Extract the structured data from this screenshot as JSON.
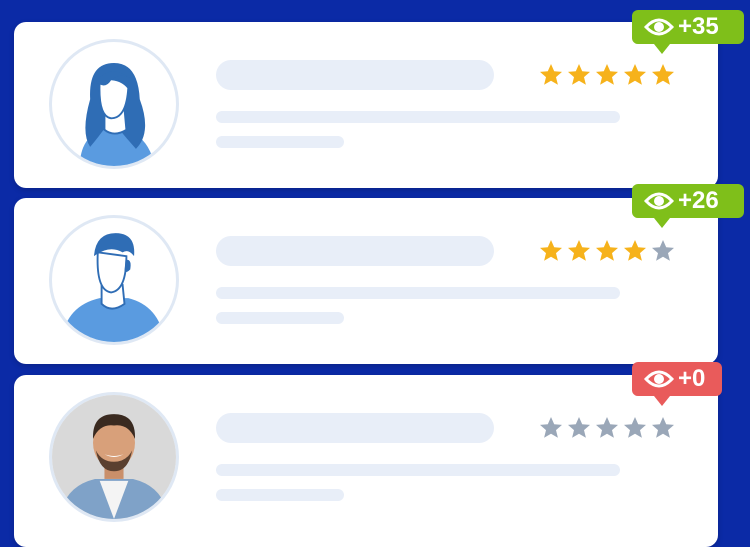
{
  "colors": {
    "background": "#0b2aa6",
    "card": "#ffffff",
    "placeholder": "#e8eef8",
    "star_filled": "#f6b21b",
    "star_empty": "#9aa7b8",
    "badge_positive": "#7fbf1a",
    "badge_zero": "#e95b5b",
    "avatar_blue": "#2f6db5",
    "avatar_light_blue": "#5a9be0"
  },
  "reviews": [
    {
      "avatar": "woman-illustration-avatar",
      "rating": 5,
      "views_delta": "+35",
      "badge_color": "#7fbf1a"
    },
    {
      "avatar": "man-illustration-avatar",
      "rating": 4,
      "views_delta": "+26",
      "badge_color": "#7fbf1a"
    },
    {
      "avatar": "man-photo-avatar",
      "rating": 0,
      "views_delta": "+0",
      "badge_color": "#e95b5b"
    }
  ],
  "badge_icon": "eye-icon",
  "rating_icon": "star-icon",
  "max_rating": 5
}
